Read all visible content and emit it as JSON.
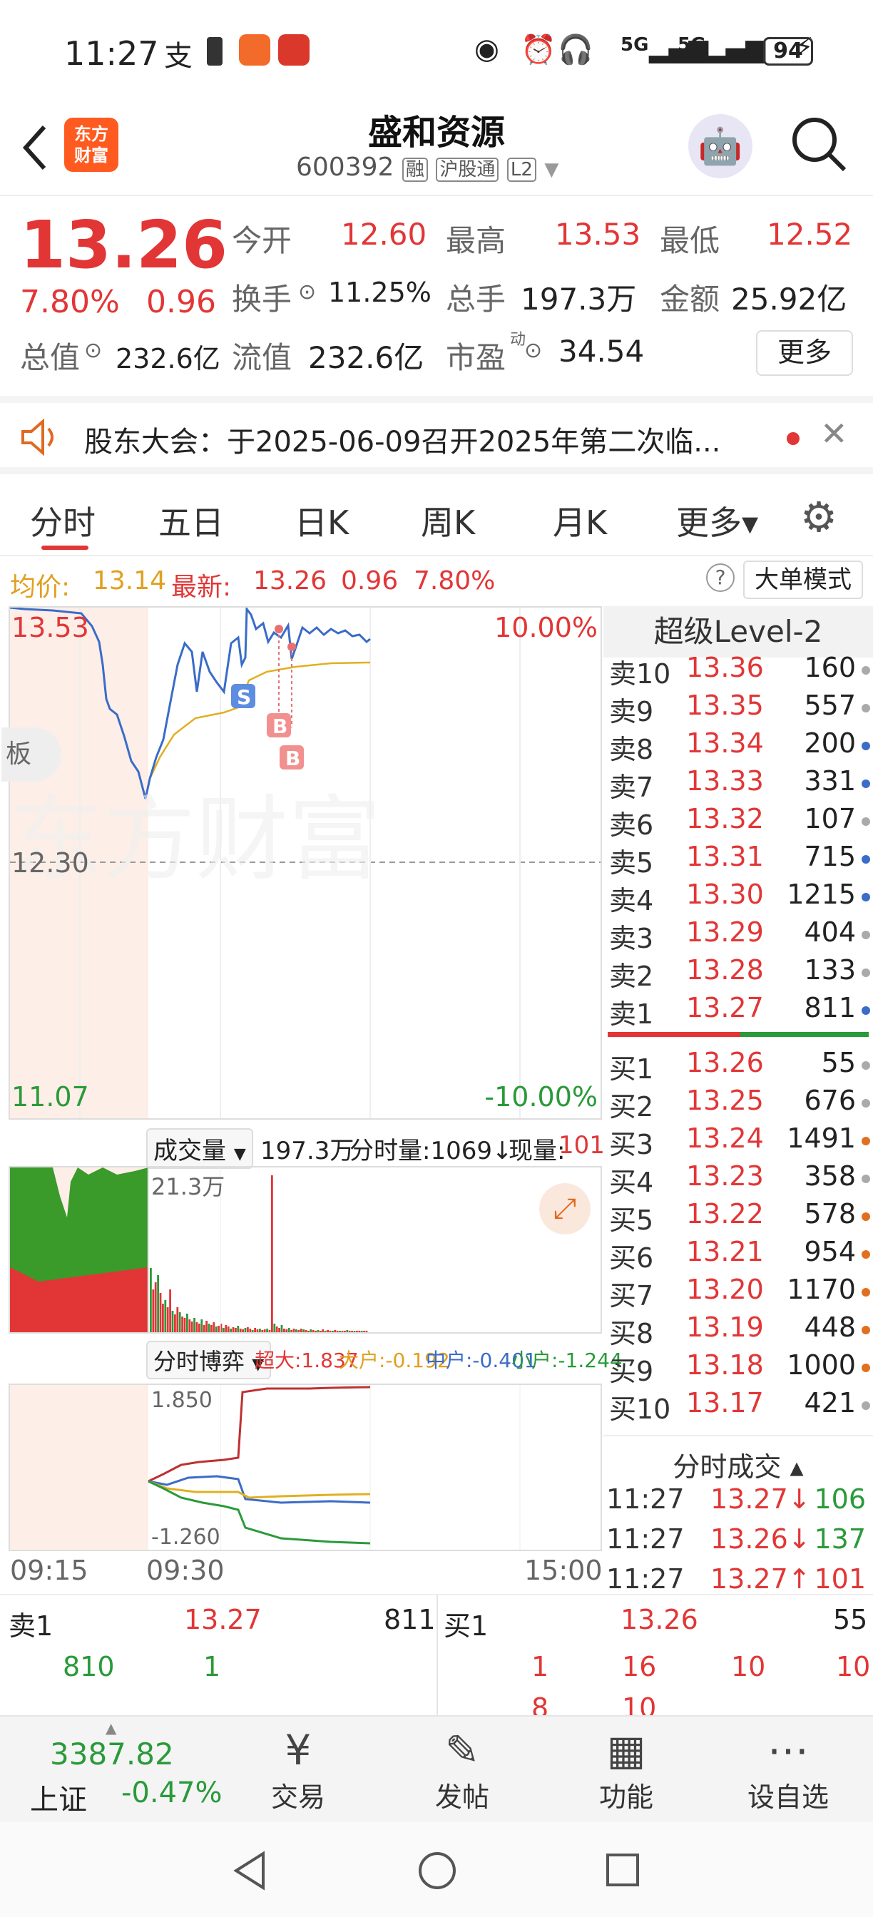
{
  "statusbar": {
    "time": "11:27",
    "battery": "94",
    "signal1": "5G",
    "signal2": "5G"
  },
  "header": {
    "logo": "东方\n财富",
    "logo_line1": "东方",
    "logo_line2": "财富",
    "title": "盛和资源",
    "code": "600392",
    "tag_rong": "融",
    "tag_hgt": "沪股通",
    "tag_l2": "L2"
  },
  "quote": {
    "price": "13.26",
    "change_pct": "7.80%",
    "change": "0.96",
    "open_label": "今开",
    "open": "12.60",
    "high_label": "最高",
    "high": "13.53",
    "low_label": "最低",
    "low": "12.52",
    "turnover_label": "换手",
    "turnover": "11.25%",
    "volume_label": "总手",
    "volume": "197.3万",
    "amount_label": "金额",
    "amount": "25.92亿",
    "mktcap_label": "总值",
    "mktcap": "232.6亿",
    "float_label": "流值",
    "float": "232.6亿",
    "pe_label": "市盈",
    "pe_sup": "动",
    "pe": "34.54",
    "more": "更多"
  },
  "notice": {
    "text": "股东大会：于2025-06-09召开2025年第二次临..."
  },
  "tabs": [
    {
      "label": "分时",
      "active": true
    },
    {
      "label": "五日"
    },
    {
      "label": "日K"
    },
    {
      "label": "周K"
    },
    {
      "label": "月K"
    },
    {
      "label": "更多▾"
    }
  ],
  "info": {
    "avg_label": "均价:",
    "avg": "13.14",
    "latest_label": "最新:",
    "latest": "13.26",
    "chg": "0.96",
    "pct": "7.80%",
    "mode": "大单模式"
  },
  "chart": {
    "y_top": "13.53",
    "y_top_pct": "10.00%",
    "y_mid": "12.30",
    "y_bottom": "11.07",
    "y_bottom_pct": "-10.00%",
    "side_label": "板",
    "watermark": "东方财富",
    "marker_s": "S",
    "marker_b": "B"
  },
  "volume": {
    "label": "成交量",
    "total": "197.3万",
    "tick_label": "分时量:1069↓",
    "now_label": "现量:",
    "now": "101",
    "max": "21.3万"
  },
  "flow": {
    "label": "分时博弈",
    "super": "超大:1.837",
    "large": "大户:-0.192",
    "medium": "中户:-0.401",
    "small": "小户:-1.244",
    "max": "1.850",
    "min": "-1.260"
  },
  "time_axis": [
    "09:15",
    "09:30",
    "15:00"
  ],
  "orderbook": {
    "title": "超级Level-2",
    "asks": [
      {
        "label": "卖10",
        "price": "13.36",
        "vol": "160",
        "dot": "#aaaaaa"
      },
      {
        "label": "卖9",
        "price": "13.35",
        "vol": "557",
        "dot": "#aaaaaa"
      },
      {
        "label": "卖8",
        "price": "13.34",
        "vol": "200",
        "dot": "#3a6cc8"
      },
      {
        "label": "卖7",
        "price": "13.33",
        "vol": "331",
        "dot": "#3a6cc8"
      },
      {
        "label": "卖6",
        "price": "13.32",
        "vol": "107",
        "dot": "#aaaaaa"
      },
      {
        "label": "卖5",
        "price": "13.31",
        "vol": "715",
        "dot": "#3a6cc8"
      },
      {
        "label": "卖4",
        "price": "13.30",
        "vol": "1215",
        "dot": "#3a6cc8"
      },
      {
        "label": "卖3",
        "price": "13.29",
        "vol": "404",
        "dot": "#aaaaaa"
      },
      {
        "label": "卖2",
        "price": "13.28",
        "vol": "133",
        "dot": "#aaaaaa"
      },
      {
        "label": "卖1",
        "price": "13.27",
        "vol": "811",
        "dot": "#3a6cc8"
      }
    ],
    "bids": [
      {
        "label": "买1",
        "price": "13.26",
        "vol": "55",
        "dot": "#aaaaaa"
      },
      {
        "label": "买2",
        "price": "13.25",
        "vol": "676",
        "dot": "#aaaaaa"
      },
      {
        "label": "买3",
        "price": "13.24",
        "vol": "1491",
        "dot": "#e07020"
      },
      {
        "label": "买4",
        "price": "13.23",
        "vol": "358",
        "dot": "#aaaaaa"
      },
      {
        "label": "买5",
        "price": "13.22",
        "vol": "578",
        "dot": "#e07020"
      },
      {
        "label": "买6",
        "price": "13.21",
        "vol": "954",
        "dot": "#e07020"
      },
      {
        "label": "买7",
        "price": "13.20",
        "vol": "1170",
        "dot": "#e07020"
      },
      {
        "label": "买8",
        "price": "13.19",
        "vol": "448",
        "dot": "#e07020"
      },
      {
        "label": "买9",
        "price": "13.18",
        "vol": "1000",
        "dot": "#e07020"
      },
      {
        "label": "买10",
        "price": "13.17",
        "vol": "421",
        "dot": "#aaaaaa"
      }
    ],
    "trades_title": "分时成交 ▴",
    "trades": [
      {
        "time": "11:27",
        "price": "13.27↓",
        "vol": "106",
        "vol_color": "#2a9a3a"
      },
      {
        "time": "11:27",
        "price": "13.26↓",
        "vol": "137",
        "vol_color": "#2a9a3a"
      },
      {
        "time": "11:27",
        "price": "13.27↑",
        "vol": "101",
        "vol_color": "#e23636"
      }
    ]
  },
  "bottom": {
    "ask_label": "卖1",
    "ask_price": "13.27",
    "ask_vol": "811",
    "ask_q1": "810",
    "ask_q2": "1",
    "bid_label": "买1",
    "bid_price": "13.26",
    "bid_vol": "55",
    "bid_q": [
      "1",
      "16",
      "10",
      "10"
    ],
    "bid_q2": [
      "8",
      "10"
    ]
  },
  "navbar": {
    "index_value": "3387.82",
    "index_name": "上证",
    "index_pct": "-0.47%",
    "items": [
      {
        "label": "交易",
        "icon": "yen-icon"
      },
      {
        "label": "发帖",
        "icon": "edit-icon"
      },
      {
        "label": "功能",
        "icon": "grid-icon"
      },
      {
        "label": "设自选",
        "icon": "more-icon"
      }
    ]
  },
  "colors": {
    "up": "#e23636",
    "down": "#2a9a3a",
    "accent": "#ff5a1f",
    "avg_line": "#e0b020",
    "price_line": "#3a6cc8"
  }
}
